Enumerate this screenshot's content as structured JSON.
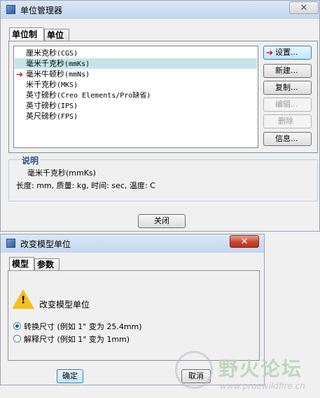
{
  "unit_manager": {
    "title": "单位管理器",
    "tabs": [
      "单位制",
      "单位"
    ],
    "systems": [
      {
        "name": "厘米克秒",
        "code": "(CGS)",
        "selected": false,
        "current": false
      },
      {
        "name": "毫米千克秒",
        "code": "(mmKs)",
        "selected": true,
        "current": false
      },
      {
        "name": "毫米牛顿秒",
        "code": "(mmNs)",
        "selected": false,
        "current": true
      },
      {
        "name": "米千克秒",
        "code": "(MKS)",
        "selected": false,
        "current": false
      },
      {
        "name": "英寸磅秒",
        "code": "(Creo Elements/Pro缺省)",
        "selected": false,
        "current": false
      },
      {
        "name": "英寸磅秒",
        "code": "(IPS)",
        "selected": false,
        "current": false
      },
      {
        "name": "英尺磅秒",
        "code": "(FPS)",
        "selected": false,
        "current": false
      }
    ],
    "buttons": {
      "set": "设置...",
      "new": "新建...",
      "copy": "复制...",
      "edit": "编辑...",
      "delete": "删除",
      "info": "信息..."
    },
    "description": {
      "label": "说明",
      "system": "毫米千克秒(mmKs)",
      "details": "长度: mm, 质量: kg, 时间: sec, 温度: C"
    },
    "close_label": "关闭"
  },
  "change_units": {
    "title": "改变模型单位",
    "tabs": [
      "模型",
      "参数"
    ],
    "heading": "改变模型单位",
    "options": [
      {
        "label": "转换尺寸 (例如 1\" 变为 25.4mm)",
        "selected": true
      },
      {
        "label": "解释尺寸 (例如 1\" 变为 1mm)",
        "selected": false
      }
    ],
    "ok_label": "确定",
    "cancel_label": "取消"
  },
  "watermark": {
    "text": "野火论坛",
    "url": "www.proewildfire.cn"
  }
}
